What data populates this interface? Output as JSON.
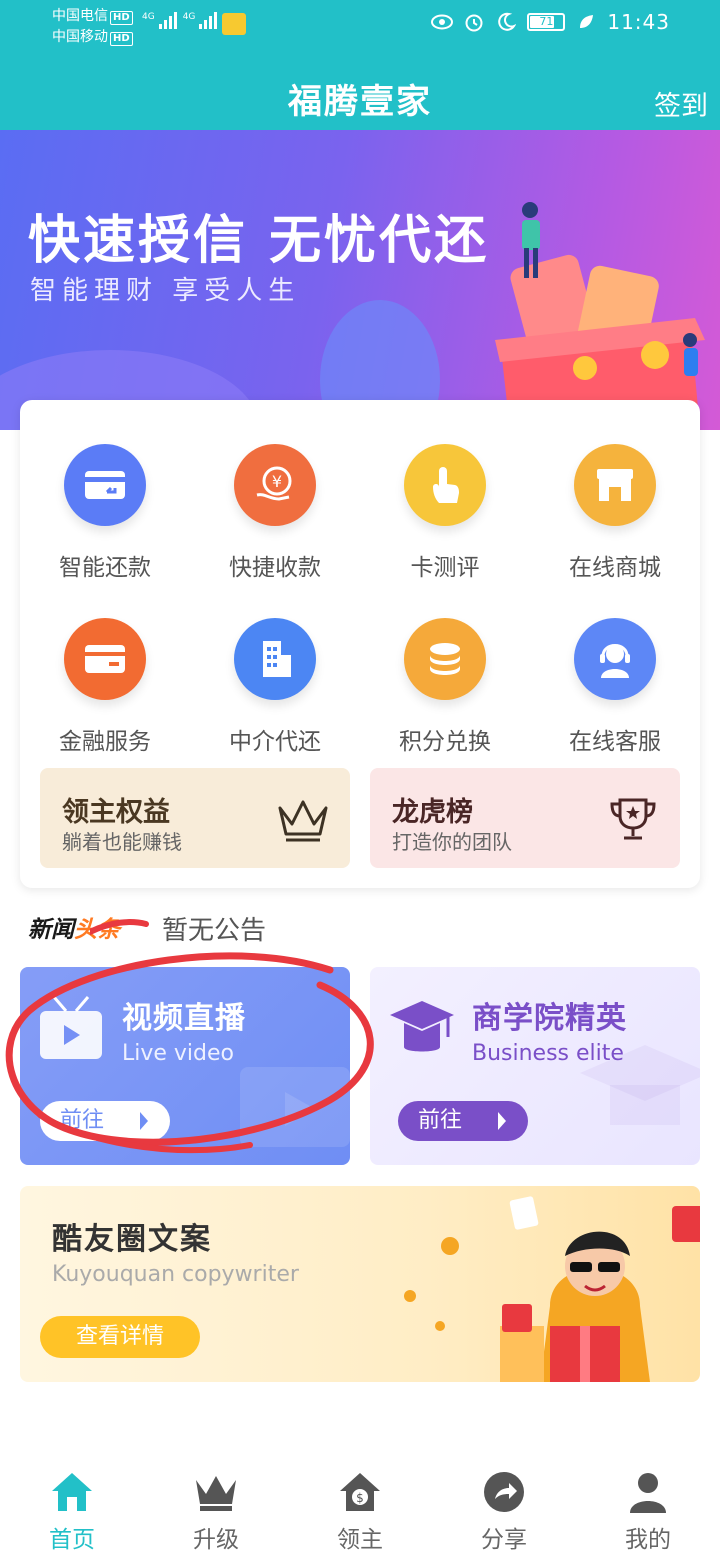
{
  "status_bar": {
    "carrier_1": "中国电信",
    "carrier_2": "中国移动",
    "hd_badge": "HD",
    "network_1": "4G",
    "network_2": "4G",
    "battery_level": "71",
    "time": "11:43"
  },
  "header": {
    "title": "福腾壹家",
    "sign_in_label": "签到"
  },
  "banner": {
    "headline": "快速授信 无忧代还",
    "subline": "智能理财 享受人生"
  },
  "services": [
    {
      "label": "智能还款",
      "icon": "card-return-icon",
      "color": "#5b7cf6"
    },
    {
      "label": "快捷收款",
      "icon": "yuan-hand-icon",
      "color": "#f06e3f"
    },
    {
      "label": "卡测评",
      "icon": "finger-tap-icon",
      "color": "#f7c63a"
    },
    {
      "label": "在线商城",
      "icon": "shop-icon",
      "color": "#f5b33d"
    },
    {
      "label": "金融服务",
      "icon": "wallet-card-icon",
      "color": "#f26b32"
    },
    {
      "label": "中介代还",
      "icon": "building-icon",
      "color": "#4c86f3"
    },
    {
      "label": "积分兑换",
      "icon": "coin-stack-icon",
      "color": "#f5a93a"
    },
    {
      "label": "在线客服",
      "icon": "headset-agent-icon",
      "color": "#5d87f6"
    }
  ],
  "promos": {
    "left": {
      "title": "领主权益",
      "subtitle": "躺着也能赚钱",
      "icon": "crown-icon"
    },
    "right": {
      "title": "龙虎榜",
      "subtitle": "打造你的团队",
      "icon": "trophy-icon"
    }
  },
  "news": {
    "label_part_1": "新闻",
    "label_part_2": "头条",
    "notice": "暂无公告"
  },
  "tiles": {
    "live": {
      "title": "视频直播",
      "subtitle": "Live video",
      "button": "前往",
      "icon": "tv-play-icon"
    },
    "business": {
      "title": "商学院精英",
      "subtitle": "Business elite",
      "button": "前往",
      "icon": "graduation-cap-icon"
    }
  },
  "copywriter": {
    "title": "酷友圈文案",
    "subtitle": "Kuyouquan copywriter",
    "button": "查看详情"
  },
  "bottom_nav": [
    {
      "label": "首页",
      "icon": "home-icon",
      "active": true
    },
    {
      "label": "升级",
      "icon": "crown-icon",
      "active": false
    },
    {
      "label": "领主",
      "icon": "house-dollar-icon",
      "active": false
    },
    {
      "label": "分享",
      "icon": "share-arrow-icon",
      "active": false
    },
    {
      "label": "我的",
      "icon": "person-icon",
      "active": false
    }
  ],
  "colors": {
    "primary": "#22c0c8",
    "orange_accent": "#ff7a22",
    "live_tile": "#7f99f6",
    "business_tile": "#eeebff",
    "business_accent": "#7a4fc8",
    "annotation_red": "#e8393f"
  }
}
